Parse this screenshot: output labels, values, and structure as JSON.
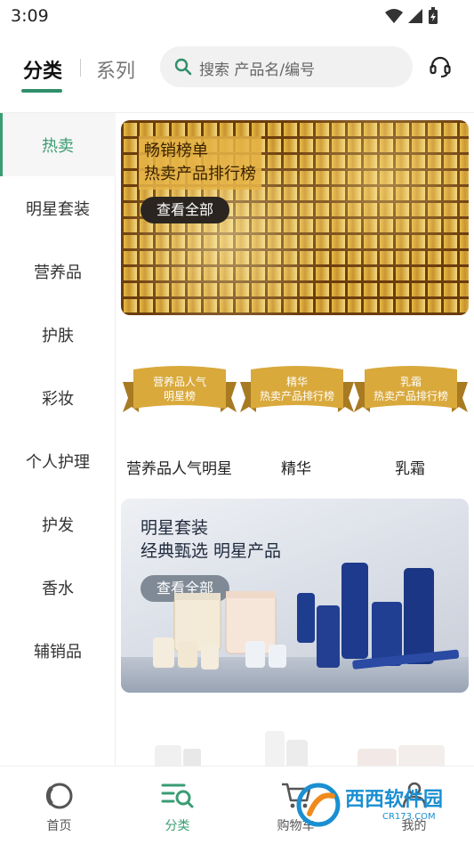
{
  "status_bar": {
    "time": "3:09"
  },
  "header": {
    "tab_category": "分类",
    "tab_series": "系列",
    "search_placeholder": "搜索 产品名/编号"
  },
  "sidebar": {
    "items": [
      {
        "label": "热卖",
        "active": true
      },
      {
        "label": "明星套装"
      },
      {
        "label": "营养品"
      },
      {
        "label": "护肤"
      },
      {
        "label": "彩妆"
      },
      {
        "label": "个人护理"
      },
      {
        "label": "护发"
      },
      {
        "label": "香水"
      },
      {
        "label": "辅销品"
      }
    ]
  },
  "main": {
    "banner_bestseller": {
      "title": "畅销榜单",
      "subtitle": "热卖产品排行榜",
      "button": "查看全部"
    },
    "ribbons": [
      {
        "line1": "营养品人气",
        "line2": "明星榜"
      },
      {
        "line1": "精华",
        "line2": "热卖产品排行榜"
      },
      {
        "line1": "乳霜",
        "line2": "热卖产品排行榜"
      }
    ],
    "ranking_labels": [
      "营养品人气明星",
      "精华",
      "乳霜"
    ],
    "banner_star_set": {
      "title": "明星套装",
      "subtitle": "经典甄选 明星产品",
      "button": "查看全部"
    }
  },
  "bottom_nav": {
    "items": [
      {
        "label": "首页",
        "icon": "home-ring-icon"
      },
      {
        "label": "分类",
        "icon": "category-search-icon",
        "active": true
      },
      {
        "label": "购物车",
        "icon": "cart-icon"
      },
      {
        "label": "我的",
        "icon": "user-icon"
      }
    ]
  },
  "watermark": {
    "text": "西西软件园",
    "sub": "CR173.COM"
  },
  "colors": {
    "accent": "#3a9c73",
    "gold": "#d9a93c"
  }
}
